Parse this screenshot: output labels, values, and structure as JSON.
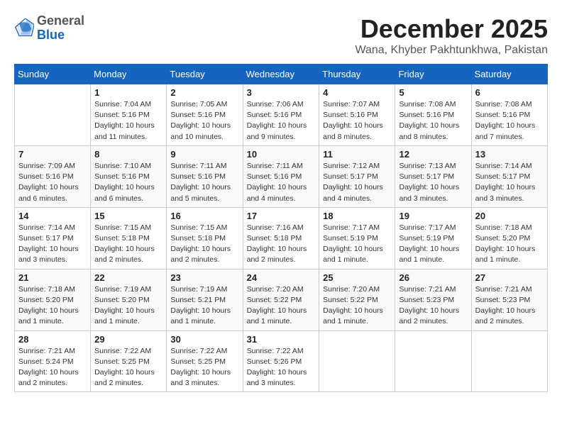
{
  "header": {
    "logo_general": "General",
    "logo_blue": "Blue",
    "month_title": "December 2025",
    "location": "Wana, Khyber Pakhtunkhwa, Pakistan"
  },
  "weekdays": [
    "Sunday",
    "Monday",
    "Tuesday",
    "Wednesday",
    "Thursday",
    "Friday",
    "Saturday"
  ],
  "weeks": [
    [
      {
        "day": "",
        "info": ""
      },
      {
        "day": "1",
        "info": "Sunrise: 7:04 AM\nSunset: 5:16 PM\nDaylight: 10 hours\nand 11 minutes."
      },
      {
        "day": "2",
        "info": "Sunrise: 7:05 AM\nSunset: 5:16 PM\nDaylight: 10 hours\nand 10 minutes."
      },
      {
        "day": "3",
        "info": "Sunrise: 7:06 AM\nSunset: 5:16 PM\nDaylight: 10 hours\nand 9 minutes."
      },
      {
        "day": "4",
        "info": "Sunrise: 7:07 AM\nSunset: 5:16 PM\nDaylight: 10 hours\nand 8 minutes."
      },
      {
        "day": "5",
        "info": "Sunrise: 7:08 AM\nSunset: 5:16 PM\nDaylight: 10 hours\nand 8 minutes."
      },
      {
        "day": "6",
        "info": "Sunrise: 7:08 AM\nSunset: 5:16 PM\nDaylight: 10 hours\nand 7 minutes."
      }
    ],
    [
      {
        "day": "7",
        "info": "Sunrise: 7:09 AM\nSunset: 5:16 PM\nDaylight: 10 hours\nand 6 minutes."
      },
      {
        "day": "8",
        "info": "Sunrise: 7:10 AM\nSunset: 5:16 PM\nDaylight: 10 hours\nand 6 minutes."
      },
      {
        "day": "9",
        "info": "Sunrise: 7:11 AM\nSunset: 5:16 PM\nDaylight: 10 hours\nand 5 minutes."
      },
      {
        "day": "10",
        "info": "Sunrise: 7:11 AM\nSunset: 5:16 PM\nDaylight: 10 hours\nand 4 minutes."
      },
      {
        "day": "11",
        "info": "Sunrise: 7:12 AM\nSunset: 5:17 PM\nDaylight: 10 hours\nand 4 minutes."
      },
      {
        "day": "12",
        "info": "Sunrise: 7:13 AM\nSunset: 5:17 PM\nDaylight: 10 hours\nand 3 minutes."
      },
      {
        "day": "13",
        "info": "Sunrise: 7:14 AM\nSunset: 5:17 PM\nDaylight: 10 hours\nand 3 minutes."
      }
    ],
    [
      {
        "day": "14",
        "info": "Sunrise: 7:14 AM\nSunset: 5:17 PM\nDaylight: 10 hours\nand 3 minutes."
      },
      {
        "day": "15",
        "info": "Sunrise: 7:15 AM\nSunset: 5:18 PM\nDaylight: 10 hours\nand 2 minutes."
      },
      {
        "day": "16",
        "info": "Sunrise: 7:15 AM\nSunset: 5:18 PM\nDaylight: 10 hours\nand 2 minutes."
      },
      {
        "day": "17",
        "info": "Sunrise: 7:16 AM\nSunset: 5:18 PM\nDaylight: 10 hours\nand 2 minutes."
      },
      {
        "day": "18",
        "info": "Sunrise: 7:17 AM\nSunset: 5:19 PM\nDaylight: 10 hours\nand 1 minute."
      },
      {
        "day": "19",
        "info": "Sunrise: 7:17 AM\nSunset: 5:19 PM\nDaylight: 10 hours\nand 1 minute."
      },
      {
        "day": "20",
        "info": "Sunrise: 7:18 AM\nSunset: 5:20 PM\nDaylight: 10 hours\nand 1 minute."
      }
    ],
    [
      {
        "day": "21",
        "info": "Sunrise: 7:18 AM\nSunset: 5:20 PM\nDaylight: 10 hours\nand 1 minute."
      },
      {
        "day": "22",
        "info": "Sunrise: 7:19 AM\nSunset: 5:20 PM\nDaylight: 10 hours\nand 1 minute."
      },
      {
        "day": "23",
        "info": "Sunrise: 7:19 AM\nSunset: 5:21 PM\nDaylight: 10 hours\nand 1 minute."
      },
      {
        "day": "24",
        "info": "Sunrise: 7:20 AM\nSunset: 5:22 PM\nDaylight: 10 hours\nand 1 minute."
      },
      {
        "day": "25",
        "info": "Sunrise: 7:20 AM\nSunset: 5:22 PM\nDaylight: 10 hours\nand 1 minute."
      },
      {
        "day": "26",
        "info": "Sunrise: 7:21 AM\nSunset: 5:23 PM\nDaylight: 10 hours\nand 2 minutes."
      },
      {
        "day": "27",
        "info": "Sunrise: 7:21 AM\nSunset: 5:23 PM\nDaylight: 10 hours\nand 2 minutes."
      }
    ],
    [
      {
        "day": "28",
        "info": "Sunrise: 7:21 AM\nSunset: 5:24 PM\nDaylight: 10 hours\nand 2 minutes."
      },
      {
        "day": "29",
        "info": "Sunrise: 7:22 AM\nSunset: 5:25 PM\nDaylight: 10 hours\nand 2 minutes."
      },
      {
        "day": "30",
        "info": "Sunrise: 7:22 AM\nSunset: 5:25 PM\nDaylight: 10 hours\nand 3 minutes."
      },
      {
        "day": "31",
        "info": "Sunrise: 7:22 AM\nSunset: 5:26 PM\nDaylight: 10 hours\nand 3 minutes."
      },
      {
        "day": "",
        "info": ""
      },
      {
        "day": "",
        "info": ""
      },
      {
        "day": "",
        "info": ""
      }
    ]
  ]
}
